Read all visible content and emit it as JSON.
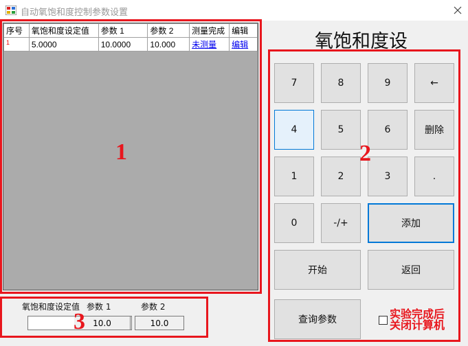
{
  "window": {
    "title": "自动氧饱和度控制参数设置"
  },
  "table": {
    "columns": [
      "序号",
      "氧饱和度设定值",
      "参数 1",
      "参数 2",
      "测量完成",
      "编辑"
    ],
    "rows": [
      {
        "index": "1",
        "setpoint": "5.0000",
        "param1": "10.0000",
        "param2": "10.000",
        "status": "未测量",
        "edit": "编辑"
      }
    ]
  },
  "keypad": {
    "heading": "氧饱和度设",
    "keys": {
      "k7": "7",
      "k8": "8",
      "k9": "9",
      "backspace": "←",
      "k4": "4",
      "k5": "5",
      "k6": "6",
      "delete": "删除",
      "k1": "1",
      "k2": "2",
      "k3": "3",
      "dot": ".",
      "k0": "0",
      "sign": "-/+",
      "add": "添加",
      "start": "开始",
      "back": "返回",
      "query": "查询参数"
    }
  },
  "inputs": {
    "setpoint_label": "氧饱和度设定值",
    "param1_label": "参数 1",
    "param2_label": "参数 2",
    "setpoint_value": "",
    "param1_value": "10.0",
    "param2_value": "10.0"
  },
  "shutdown": {
    "label": "实验完成后关闭计算机",
    "checked": false
  },
  "annotations": [
    "1",
    "2",
    "3"
  ],
  "colors": {
    "annotation": "#e8161d",
    "link": "#0000ee",
    "accent": "#0078d7"
  }
}
